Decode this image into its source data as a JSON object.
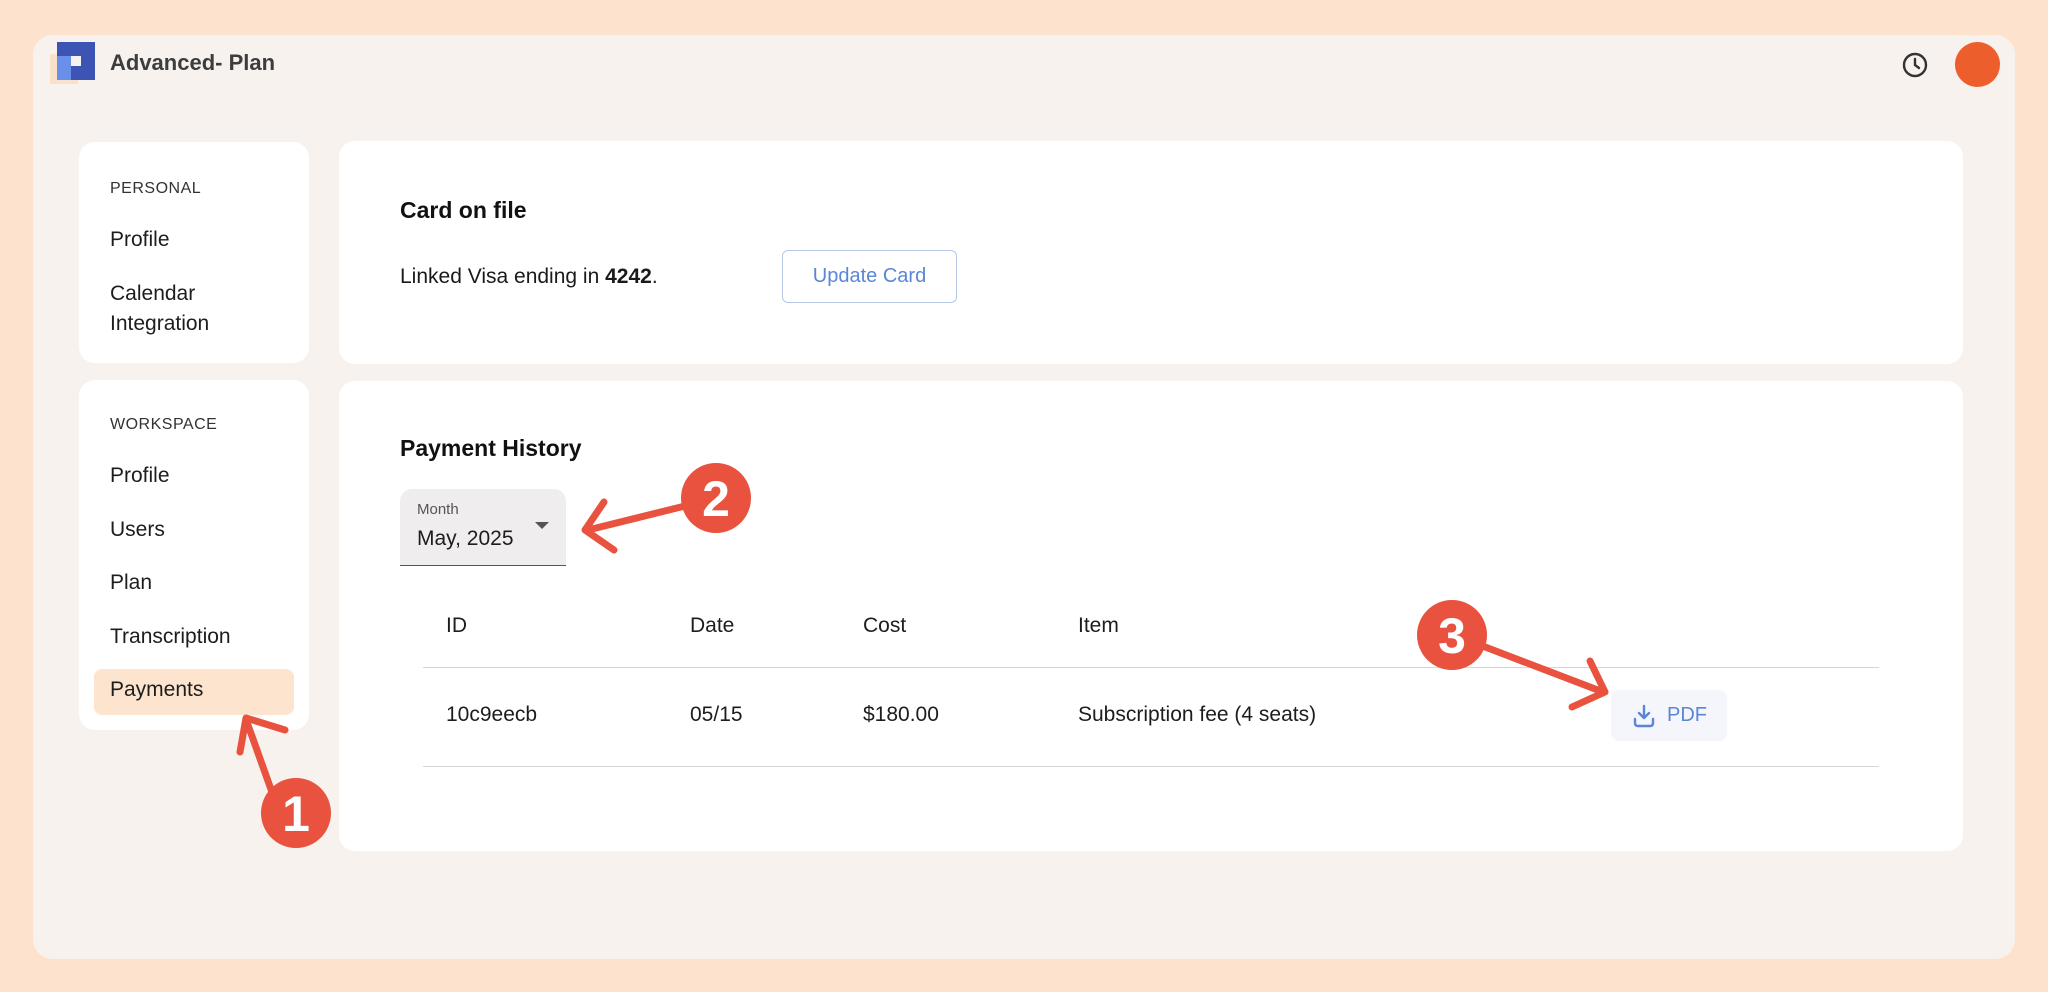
{
  "header": {
    "plan_title": "Advanced- Plan",
    "logo_icon": "app-logo-icon",
    "history_icon": "clock-icon"
  },
  "colors": {
    "accent": "#ec5f2c",
    "link_blue": "#5a86d6",
    "annotation_red": "#e8523f",
    "active_bg": "#fce4cf"
  },
  "sidebar": {
    "personal": {
      "label": "PERSONAL",
      "items": [
        {
          "label": "Profile"
        },
        {
          "label": "Calendar Integration"
        }
      ]
    },
    "workspace": {
      "label": "WORKSPACE",
      "items": [
        {
          "label": "Profile"
        },
        {
          "label": "Users"
        },
        {
          "label": "Plan"
        },
        {
          "label": "Transcription"
        },
        {
          "label": "Payments",
          "active": true
        }
      ]
    }
  },
  "card_on_file": {
    "title": "Card on file",
    "text_prefix": "Linked Visa ending in ",
    "last4": "4242",
    "text_suffix": ".",
    "update_button": "Update Card"
  },
  "payment_history": {
    "title": "Payment History",
    "month_select": {
      "label": "Month",
      "value": "May, 2025"
    },
    "columns": [
      "ID",
      "Date",
      "Cost",
      "Item"
    ],
    "rows": [
      {
        "id": "10c9eecb",
        "date": "05/15",
        "cost": "$180.00",
        "item": "Subscription fee (4 seats)",
        "action": "PDF"
      }
    ]
  },
  "annotations": {
    "one": "1",
    "two": "2",
    "three": "3"
  }
}
